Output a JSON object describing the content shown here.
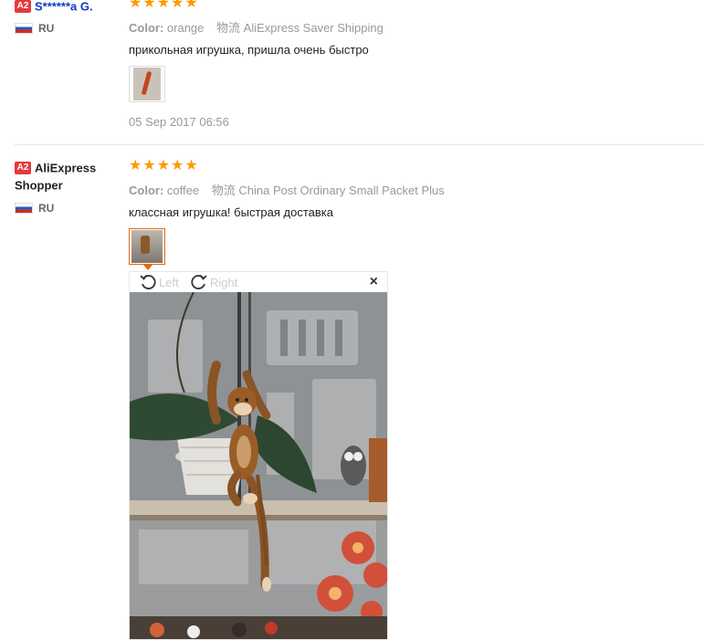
{
  "reviews": [
    {
      "badge": "A2",
      "user": "S******a G.",
      "country": "RU",
      "stars": "★★★★★",
      "color_label": "Color:",
      "color_value": "orange",
      "shipping_label": "物流",
      "shipping_value": "AliExpress Saver Shipping",
      "text": "прикольная игрушка, пришла очень быстро",
      "date": "05 Sep 2017 06:56"
    },
    {
      "badge": "A2",
      "user_line1": "AliExpress",
      "user_line2": "Shopper",
      "country": "RU",
      "stars": "★★★★★",
      "color_label": "Color:",
      "color_value": "coffee",
      "shipping_label": "物流",
      "shipping_value": "China Post Ordinary Small Packet Plus",
      "text": "классная игрушка! быстрая доставка"
    }
  ],
  "viewer": {
    "rotate_left": "Left",
    "rotate_right": "Right",
    "close": "×"
  },
  "colors": {
    "accent": "#e4680c",
    "star": "#ff9900",
    "badge": "#e4393c",
    "link": "#0b3cc1"
  }
}
